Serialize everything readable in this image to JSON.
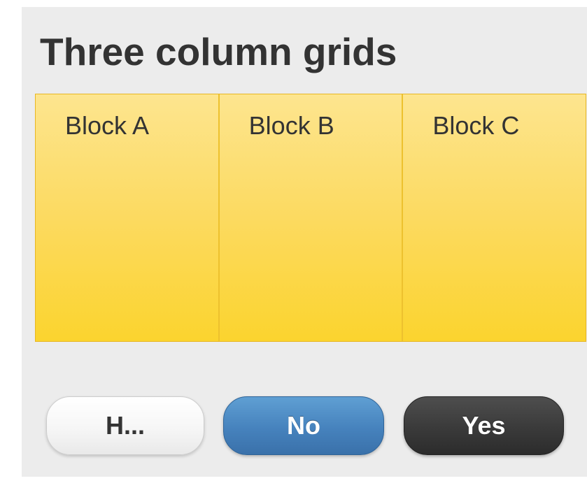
{
  "page": {
    "title": "Three column grids"
  },
  "grid": {
    "blocks": [
      {
        "label": "Block A"
      },
      {
        "label": "Block B"
      },
      {
        "label": "Block C"
      }
    ],
    "colors": {
      "fill_top": "#fde58f",
      "fill_bottom": "#fbd42e",
      "border": "#e8b722"
    }
  },
  "buttons": {
    "h_label": "H...",
    "no_label": "No",
    "yes_label": "Yes",
    "colors": {
      "h": "#f6f6f6",
      "no": "#4682bd",
      "yes": "#3a3a3a"
    }
  }
}
